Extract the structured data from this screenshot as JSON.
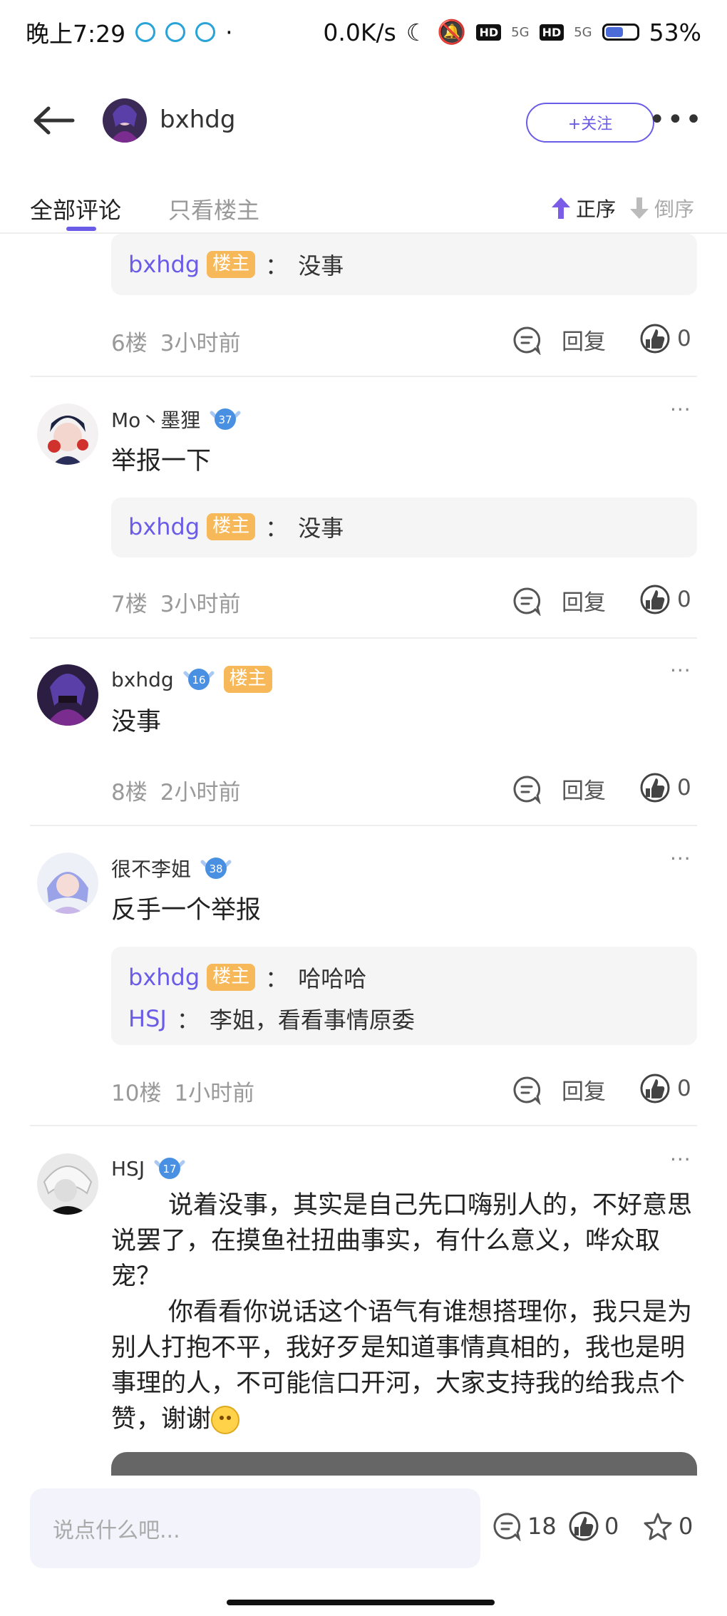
{
  "status": {
    "time": "晚上7:29",
    "speed": "0.0K/s",
    "hd": "HD",
    "net": "5G",
    "battery": "53%"
  },
  "header": {
    "username": "bxhdg",
    "follow_label": "+关注",
    "more_label": "•••"
  },
  "tabs": {
    "all": "全部评论",
    "op_only": "只看楼主",
    "asc": "正序",
    "desc": "倒序"
  },
  "op_tag": "楼主",
  "colon": "：",
  "reply_label": "回复",
  "more_label": "···",
  "comments": [
    {
      "quotes": [
        {
          "name": "bxhdg",
          "is_op": true,
          "text": "没事"
        }
      ],
      "floor": "6楼",
      "time": "3小时前",
      "likes": "0"
    },
    {
      "name": "Mo丶墨狸",
      "level": "37",
      "text": "举报一下",
      "quotes": [
        {
          "name": "bxhdg",
          "is_op": true,
          "text": "没事"
        }
      ],
      "floor": "7楼",
      "time": "3小时前",
      "likes": "0"
    },
    {
      "name": "bxhdg",
      "level": "16",
      "is_op": true,
      "text": "没事",
      "floor": "8楼",
      "time": "2小时前",
      "likes": "0"
    },
    {
      "name": "很不李姐",
      "level": "38",
      "text": "反手一个举报",
      "quotes": [
        {
          "name": "bxhdg",
          "is_op": true,
          "text": "哈哈哈"
        },
        {
          "name": "HSJ",
          "is_op": false,
          "text": "李姐，看看事情原委"
        }
      ],
      "floor": "10楼",
      "time": "1小时前",
      "likes": "0"
    },
    {
      "name": "HSJ",
      "level": "17",
      "paragraphs": [
        "说着没事，其实是自己先口嗨别人的，不好意思说罢了，在摸鱼社扭曲事实，有什么意义，哗众取宠？",
        "你看看你说话这个语气有谁想搭理你，我只是为别人打抱不平，我好歹是知道事情真相的，我也是明事理的人，不可能信口开河，大家支持我的给我点个赞，谢谢"
      ]
    }
  ],
  "bottom": {
    "placeholder": "说点什么吧...",
    "comments": "18",
    "likes": "0",
    "favs": "0"
  },
  "colors": {
    "accent": "#6b5ce7",
    "op_tag": "#f7b85a",
    "level_badge": "#4a90e2"
  }
}
